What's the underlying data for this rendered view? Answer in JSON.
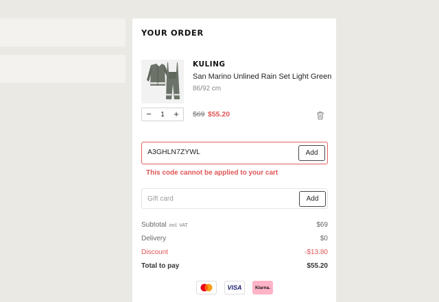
{
  "order": {
    "title": "YOUR ORDER",
    "item": {
      "brand": "KULING",
      "name": "San Marino Unlined Rain Set Light Green",
      "size": "86/92 cm",
      "quantity": "1",
      "qty_minus": "−",
      "qty_plus": "+",
      "price_original": "$69",
      "price_sale": "$55.20"
    },
    "discount_code": {
      "value": "A3GHLN7ZYWL",
      "add_label": "Add",
      "error": "This code cannot be applied to your cart"
    },
    "gift_card": {
      "placeholder": "Gift card",
      "add_label": "Add"
    },
    "summary": {
      "subtotal_label": "Subtotal",
      "subtotal_note": "incl. VAT",
      "subtotal_value": "$69",
      "delivery_label": "Delivery",
      "delivery_value": "$0",
      "discount_label": "Discount",
      "discount_value": "-$13.80",
      "total_label": "Total to pay",
      "total_value": "$55.20"
    },
    "payment_methods": [
      {
        "name": "mastercard-icon"
      },
      {
        "name": "visa-icon",
        "label": "VISA"
      },
      {
        "name": "klarna-icon",
        "label": "Klarna."
      }
    ]
  },
  "colors": {
    "background": "#ebe9e4",
    "panel": "#ffffff",
    "error": "#e05454",
    "klarna": "#ffb3c7",
    "visa": "#1a1f71"
  }
}
